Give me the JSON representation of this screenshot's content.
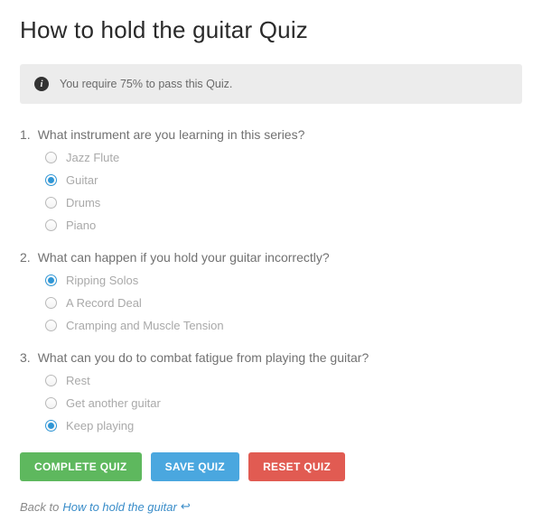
{
  "title": "How to hold the guitar Quiz",
  "notice": {
    "text": "You require 75% to pass this Quiz."
  },
  "questions": [
    {
      "number": "1.",
      "text": "What instrument are you learning in this series?",
      "options": [
        {
          "label": "Jazz Flute",
          "selected": false
        },
        {
          "label": "Guitar",
          "selected": true
        },
        {
          "label": "Drums",
          "selected": false
        },
        {
          "label": "Piano",
          "selected": false
        }
      ]
    },
    {
      "number": "2.",
      "text": "What can happen if you hold your guitar incorrectly?",
      "options": [
        {
          "label": "Ripping Solos",
          "selected": true
        },
        {
          "label": "A Record Deal",
          "selected": false
        },
        {
          "label": "Cramping and Muscle Tension",
          "selected": false
        }
      ]
    },
    {
      "number": "3.",
      "text": "What can you do to combat fatigue from playing the guitar?",
      "options": [
        {
          "label": "Rest",
          "selected": false
        },
        {
          "label": "Get another guitar",
          "selected": false
        },
        {
          "label": "Keep playing",
          "selected": true
        }
      ]
    }
  ],
  "buttons": {
    "complete": "COMPLETE QUIZ",
    "save": "SAVE QUIZ",
    "reset": "RESET QUIZ"
  },
  "back": {
    "prefix": "Back to ",
    "link": "How to hold the guitar"
  }
}
